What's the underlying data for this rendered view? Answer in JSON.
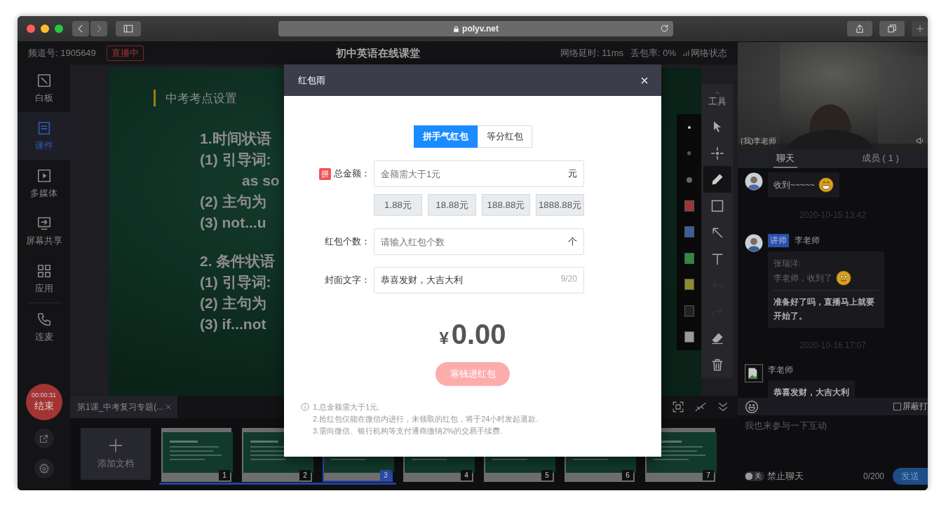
{
  "browser": {
    "url": "polyv.net"
  },
  "topbar": {
    "channel": "频道号: 1905649",
    "live_badge": "直播中",
    "title": "初中英语在线课堂",
    "latency": "网络延时: 11ms",
    "packet_loss": "丢包率: 0%",
    "network": "网络状态"
  },
  "nav": {
    "items": [
      {
        "label": "白板",
        "selected": false
      },
      {
        "label": "课件",
        "selected": true
      },
      {
        "label": "多媒体",
        "selected": false
      },
      {
        "label": "屏幕共享",
        "selected": false
      },
      {
        "label": "应用",
        "selected": false
      },
      {
        "label": "连麦",
        "selected": false
      }
    ],
    "timer": "00:00:31",
    "end_button": "结束"
  },
  "slide": {
    "heading": "中考考点设置",
    "lines": [
      {
        "kind": "title",
        "text": "1.时间状语"
      },
      {
        "kind": "item",
        "text": "(1) 引导词:"
      },
      {
        "kind": "continuation",
        "text": "as so"
      },
      {
        "kind": "item",
        "text": "(2) 主句为"
      },
      {
        "kind": "item",
        "text": "(3) not...u"
      },
      {
        "kind": "title",
        "text": "2. 条件状语"
      },
      {
        "kind": "item",
        "text": "(1) 引导词:"
      },
      {
        "kind": "item",
        "text": "(2) 主句为"
      },
      {
        "kind": "item",
        "text": "(3) if...not"
      }
    ]
  },
  "tools": {
    "label": "工具",
    "items": [
      {
        "selected": false,
        "disabled": false
      },
      {
        "selected": false,
        "disabled": false
      },
      {
        "selected": true,
        "disabled": false
      },
      {
        "selected": false,
        "disabled": false
      },
      {
        "selected": false,
        "disabled": false
      },
      {
        "selected": false,
        "disabled": false
      },
      {
        "selected": false,
        "disabled": true
      },
      {
        "selected": false,
        "disabled": true
      },
      {
        "selected": false,
        "disabled": false
      },
      {
        "selected": false,
        "disabled": false
      }
    ]
  },
  "palette": [
    {
      "color": "#9e3434"
    },
    {
      "color": "#3a5f9c"
    },
    {
      "color": "#2f8a44"
    },
    {
      "color": "#8f8a2c"
    },
    {
      "color": "#222222"
    },
    {
      "color": "#9a9a9a"
    }
  ],
  "document_tab": {
    "label": "第1课_中考复习专题(..."
  },
  "thumbnails": {
    "add_label": "添加文档",
    "items": [
      {
        "number": "1",
        "selected": false
      },
      {
        "number": "2",
        "selected": false
      },
      {
        "number": "3",
        "selected": true
      },
      {
        "number": "4",
        "selected": false
      },
      {
        "number": "5",
        "selected": false
      },
      {
        "number": "6",
        "selected": false
      },
      {
        "number": "7",
        "selected": false
      }
    ]
  },
  "video": {
    "name": "(我)李老师"
  },
  "panel_tabs": [
    {
      "label": "聊天",
      "selected": true
    },
    {
      "label": "成员 ( 1 )",
      "selected": false
    }
  ],
  "chat": [
    {
      "kind": "message",
      "text": "收到~~~~~",
      "emoji": true
    },
    {
      "kind": "time",
      "text": "2020-10-15 13:42"
    },
    {
      "kind": "message",
      "badge": "讲师",
      "name": "李老师",
      "quote_name": "张瑞洋:",
      "quote_text": "李老师，收到了",
      "quote_emoji": true,
      "text": "准备好了吗，直播马上就要开始了。"
    },
    {
      "kind": "time",
      "text": "2020-10-16 17:07"
    },
    {
      "kind": "message",
      "name": "李老师",
      "text": "恭喜发财，大吉大利"
    }
  ],
  "chat_input": {
    "block_label": "屏蔽打",
    "block_checked": false,
    "placeholder": "我也来参与一下互动",
    "mute_toggle": "关",
    "mute_on": false,
    "mute_label": "禁止聊天",
    "counter": "0/200",
    "send": "发送"
  },
  "modal": {
    "title": "红包雨",
    "types": [
      {
        "label": "拼手气红包",
        "selected": true
      },
      {
        "label": "等分红包",
        "selected": false
      }
    ],
    "amount": {
      "badge": "拼",
      "label": "总金额：",
      "placeholder": "金额需大于1元",
      "unit": "元"
    },
    "presets": [
      "1.88元",
      "18.88元",
      "188.88元",
      "1888.88元"
    ],
    "count": {
      "label": "红包个数：",
      "placeholder": "请输入红包个数",
      "unit": "个"
    },
    "cover": {
      "label": "封面文字：",
      "value": "恭喜发财，大吉大利",
      "counter": "9/20"
    },
    "currency": "¥",
    "total": "0.00",
    "submit": {
      "label": "塞钱进红包",
      "disabled": true
    },
    "notes": [
      "1.总金额需大于1元.",
      "2.抢红包仅能在微信内进行，未领取的红包，将于24小时发起退款.",
      "3.需向微信、银行机构等支付通商缴纳2%的交易手续费."
    ]
  }
}
